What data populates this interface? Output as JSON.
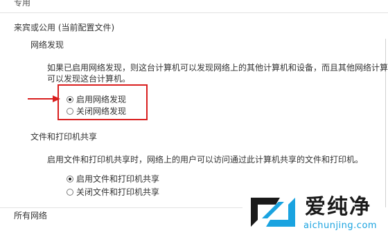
{
  "top_section": {
    "label": "专用"
  },
  "profile": {
    "title": "来宾或公用 (当前配置文件)"
  },
  "network_discovery": {
    "heading": "网络发现",
    "description_line1": "如果已启用网络发现，则这台计算机可以发现网络上的其他计算机和设备，而且其他网络计算",
    "description_line2": "可以发现这台计算机。",
    "options": [
      {
        "label": "启用网络发现",
        "selected": true
      },
      {
        "label": "关闭网络发现",
        "selected": false
      }
    ]
  },
  "file_sharing": {
    "heading": "文件和打印机共享",
    "description": "启用文件和打印机共享时，网络上的用户可以访问通过此计算机共享的文件和打印机。",
    "options": [
      {
        "label": "启用文件和打印机共享",
        "selected": true
      },
      {
        "label": "关闭文件和打印机共享",
        "selected": false
      }
    ]
  },
  "all_networks": {
    "label": "所有网络"
  },
  "annotation": {
    "highlight_color": "#d91e1e"
  },
  "watermark": {
    "title": "爱纯净",
    "url": "aichunjing.com",
    "icon": "aichunjing-logo-icon",
    "accent_color": "#1aa3e0"
  }
}
